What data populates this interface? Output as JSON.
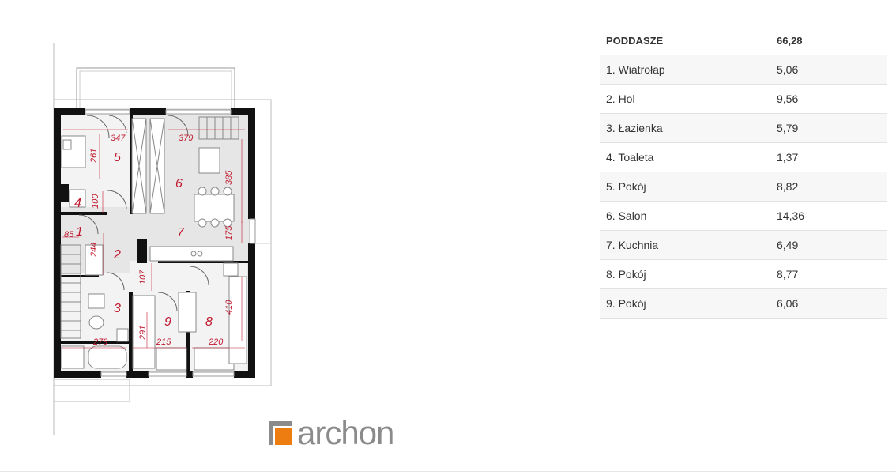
{
  "plan": {
    "rooms": [
      {
        "num": "1"
      },
      {
        "num": "2"
      },
      {
        "num": "3"
      },
      {
        "num": "4"
      },
      {
        "num": "5"
      },
      {
        "num": "6"
      },
      {
        "num": "7"
      },
      {
        "num": "8"
      },
      {
        "num": "9"
      }
    ],
    "dimensions": [
      "347",
      "379",
      "261",
      "385",
      "100",
      "85",
      "244",
      "175",
      "107",
      "410",
      "279",
      "291",
      "215",
      "220"
    ]
  },
  "brand": {
    "name": "archon",
    "colors": {
      "orange": "#ee7d11",
      "grey": "#8b8b8b"
    }
  },
  "areas": {
    "header": {
      "label": "PODDASZE",
      "value": "66,28"
    },
    "rows": [
      {
        "label": "1. Wiatrołap",
        "value": "5,06"
      },
      {
        "label": "2. Hol",
        "value": "9,56"
      },
      {
        "label": "3. Łazienka",
        "value": "5,79"
      },
      {
        "label": "4. Toaleta",
        "value": "1,37"
      },
      {
        "label": "5. Pokój",
        "value": "8,82"
      },
      {
        "label": "6. Salon",
        "value": "14,36"
      },
      {
        "label": "7. Kuchnia",
        "value": "6,49"
      },
      {
        "label": "8. Pokój",
        "value": "8,77"
      },
      {
        "label": "9. Pokój",
        "value": "6,06"
      }
    ]
  }
}
